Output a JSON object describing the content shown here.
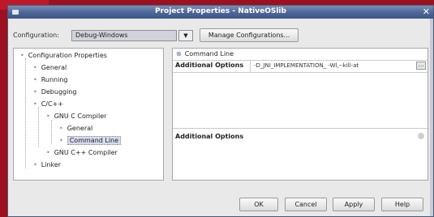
{
  "window": {
    "title": "Project Properties - NativeOSlib",
    "close_glyph": "✕"
  },
  "configuration": {
    "label": "Configuration:",
    "value": "Debug-Windows",
    "dropdown_glyph": "▼",
    "manage_label": "Manage Configurations..."
  },
  "tree": {
    "items": [
      {
        "label": "Configuration Properties"
      },
      {
        "label": "General"
      },
      {
        "label": "Running"
      },
      {
        "label": "Debugging"
      },
      {
        "label": "C/C++"
      },
      {
        "label": "GNU C Compiler"
      },
      {
        "label": "General"
      },
      {
        "label": "Command Line",
        "selected": true
      },
      {
        "label": "GNU C++ Compiler"
      },
      {
        "label": "Linker"
      }
    ]
  },
  "properties": {
    "category": "Command Line",
    "rows": [
      {
        "name": "Additional Options",
        "value": "-D_JNI_IMPLEMENTATION_ -Wl,--kill-at",
        "more": "..."
      }
    ],
    "description_title": "Additional Options"
  },
  "buttons": {
    "ok": "OK",
    "cancel": "Cancel",
    "apply": "Apply",
    "help": "Help"
  },
  "icons": {
    "tree_node": "•",
    "category_toggle": "⊕"
  }
}
